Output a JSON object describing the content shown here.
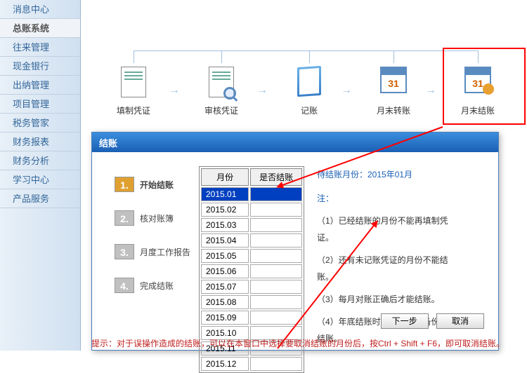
{
  "sidebar": {
    "items": [
      {
        "label": "消息中心"
      },
      {
        "label": "总账系统",
        "active": true
      },
      {
        "label": "往来管理"
      },
      {
        "label": "现金银行"
      },
      {
        "label": "出纳管理"
      },
      {
        "label": "项目管理"
      },
      {
        "label": "税务管家"
      },
      {
        "label": "财务报表"
      },
      {
        "label": "财务分析"
      },
      {
        "label": "学习中心"
      },
      {
        "label": "产品服务"
      }
    ]
  },
  "workflow": {
    "nodes": [
      {
        "label": "填制凭证",
        "icon": "doc"
      },
      {
        "label": "审核凭证",
        "icon": "doc-magnify"
      },
      {
        "label": "记账",
        "icon": "book"
      },
      {
        "label": "月末转账",
        "icon": "calendar"
      },
      {
        "label": "月末结账",
        "icon": "calendar-gear"
      }
    ]
  },
  "dialog": {
    "title": "结账",
    "steps": [
      {
        "num": "1.",
        "label": "开始结账",
        "active": true
      },
      {
        "num": "2.",
        "label": "核对账簿"
      },
      {
        "num": "3.",
        "label": "月度工作报告"
      },
      {
        "num": "4.",
        "label": "完成结账"
      }
    ],
    "table": {
      "headers": [
        "月份",
        "是否结账"
      ],
      "rows": [
        {
          "m": "2015.01",
          "s": "",
          "sel": true
        },
        {
          "m": "2015.02",
          "s": ""
        },
        {
          "m": "2015.03",
          "s": ""
        },
        {
          "m": "2015.04",
          "s": ""
        },
        {
          "m": "2015.05",
          "s": ""
        },
        {
          "m": "2015.06",
          "s": ""
        },
        {
          "m": "2015.07",
          "s": ""
        },
        {
          "m": "2015.08",
          "s": ""
        },
        {
          "m": "2015.09",
          "s": ""
        },
        {
          "m": "2015.10",
          "s": ""
        },
        {
          "m": "2015.11",
          "s": ""
        },
        {
          "m": "2015.12",
          "s": ""
        }
      ]
    },
    "pending": "待结账月份：2015年01月",
    "notes_title": "注：",
    "rules": [
      "（1）已经结账的月份不能再填制凭证。",
      "（2）还有未记账凭证的月份不能结账。",
      "（3）每月对账正确后才能结账。",
      "（4）年底结账时先进行数据备份后再结账。"
    ],
    "buttons": {
      "next": "下一步",
      "cancel": "取消"
    }
  },
  "hint": "提示：对于误操作造成的结账，可以在本窗口中选择要取消结账的月份后，按Ctrl + Shift + F6，即可取消结账。"
}
